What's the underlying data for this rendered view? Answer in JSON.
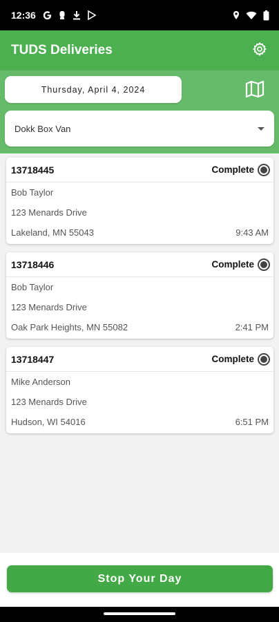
{
  "status_bar": {
    "time": "12:36",
    "left_icons": [
      "google-icon",
      "notification-icon",
      "download-icon",
      "play-store-icon"
    ],
    "right_icons": [
      "location-icon",
      "wifi-icon",
      "battery-icon"
    ]
  },
  "app_bar": {
    "title": "TUDS Deliveries",
    "settings_icon": "gear-icon"
  },
  "filters": {
    "date": "Thursday, April 4, 2024",
    "map_icon": "map-icon",
    "vehicle": "Dokk Box Van"
  },
  "deliveries": [
    {
      "order": "13718445",
      "status": "Complete",
      "name": "Bob Taylor",
      "address": "123 Menards Drive",
      "city": "Lakeland, MN 55043",
      "time": "9:43 AM"
    },
    {
      "order": "13718446",
      "status": "Complete",
      "name": "Bob Taylor",
      "address": "123 Menards Drive",
      "city": "Oak Park Heights, MN 55082",
      "time": "2:41 PM"
    },
    {
      "order": "13718447",
      "status": "Complete",
      "name": "Mike Anderson",
      "address": "123 Menards Drive",
      "city": "Hudson, WI 54016",
      "time": "6:51 PM"
    }
  ],
  "actions": {
    "stop_label": "Stop Your Day"
  },
  "colors": {
    "app_bar": "#4caf50",
    "panel": "#66bb6a",
    "button": "#43a947"
  }
}
